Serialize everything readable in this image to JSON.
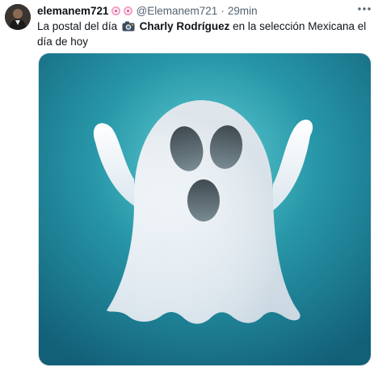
{
  "tweet": {
    "display_name": "elemanem721",
    "badge_icons": [
      "lollipop-icon",
      "lollipop-icon"
    ],
    "handle": "@Elemanem721",
    "separator": "·",
    "time": "29min",
    "text_before": "La postal del día",
    "camera_icon": "camera-icon",
    "text_bold": "Charly Rodríguez",
    "text_after": "en la selección Mexicana el día de hoy",
    "more_icon": "more-options-icon"
  },
  "media": {
    "subject": "ghost-illustration",
    "bg_color": "#1f7d93",
    "accent": "#5ec8d0"
  }
}
